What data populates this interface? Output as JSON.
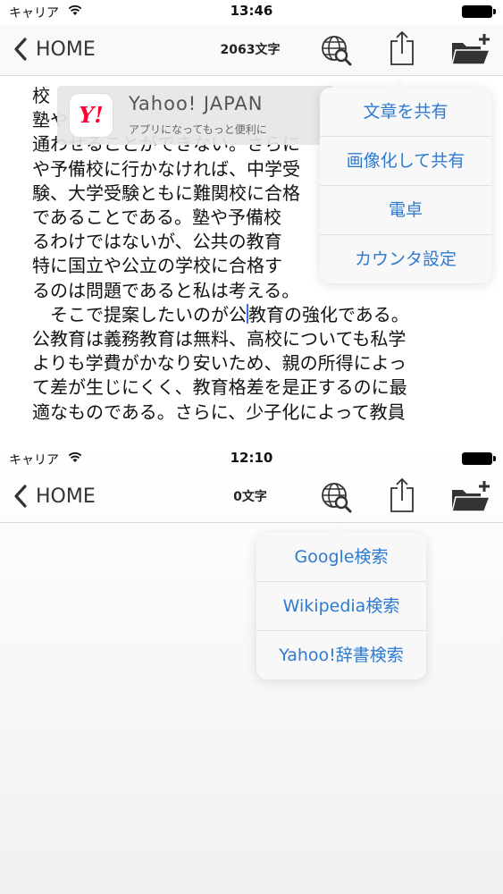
{
  "screen1": {
    "status": {
      "carrier": "キャリア",
      "time": "13:46"
    },
    "nav": {
      "back_label": "HOME",
      "count": "2063文字"
    },
    "text_lines": [
      "校",
      "塾や",
      "通わせることができない。さらに",
      "や予備校に行かなければ、中学受",
      "験、大学受験ともに難関校に合格",
      "であることである。塾や予備校",
      "るわけではないが、公共の教育",
      "特に国立や公立の学校に合格す",
      "るのは問題であると私は考える。"
    ],
    "line10_before": "　そこで提案したいのが公",
    "line10_after": "教育の強化である。",
    "text_lines_b": [
      "公教育は義務教育は無料、高校についても私学",
      "よりも学費がかなり安いため、親の所得によっ",
      "て差が生じにくく、教育格差を是正するのに最",
      "適なものである。さらに、少子化によって教員"
    ],
    "banner": {
      "icon_text": "Y!",
      "title": "Yahoo! JAPAN",
      "subtitle": "アプリになってもっと便利に"
    },
    "menu": [
      "文章を共有",
      "画像化して共有",
      "電卓",
      "カウンタ設定"
    ]
  },
  "screen2": {
    "status": {
      "carrier": "キャリア",
      "time": "12:10"
    },
    "nav": {
      "back_label": "HOME",
      "count": "0文字"
    },
    "menu": [
      "Google検索",
      "Wikipedia検索",
      "Yahoo!辞書検索"
    ]
  },
  "colors": {
    "menu_text": "#2e7ad0",
    "cursor": "#3b6fd8",
    "yahoo_red": "#ff0033"
  }
}
